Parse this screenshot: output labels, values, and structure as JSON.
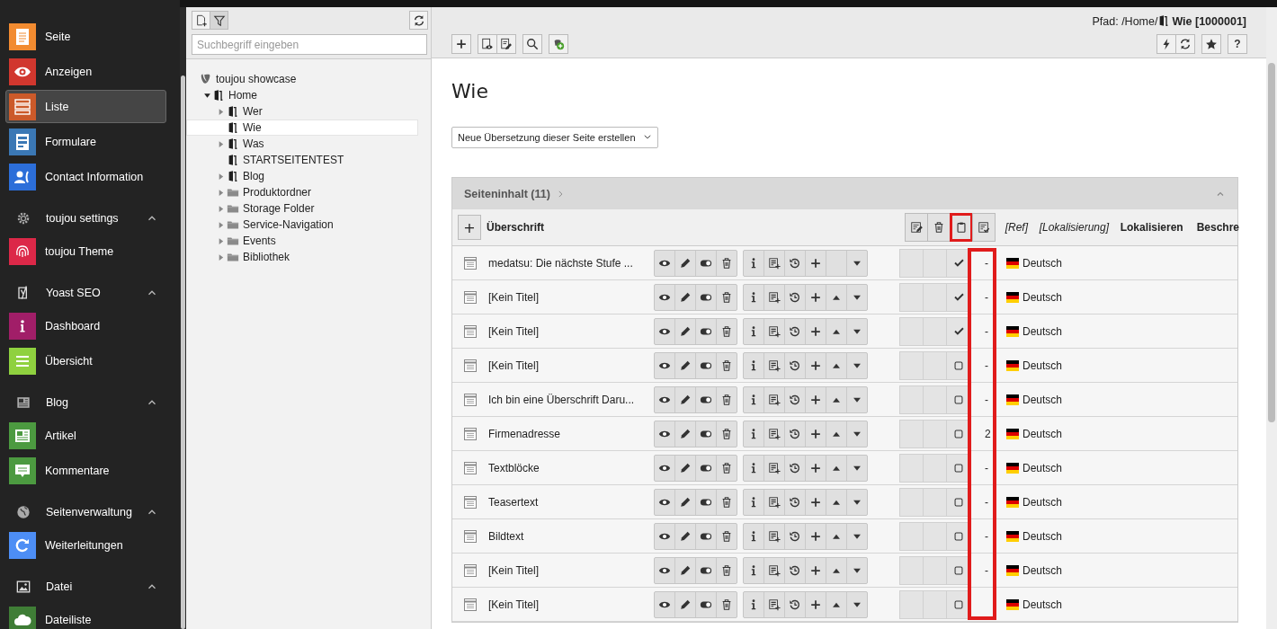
{
  "sidebar": {
    "items": [
      {
        "kind": "module",
        "label": "Seite",
        "color": "#f28b30",
        "selected": false
      },
      {
        "kind": "module",
        "label": "Anzeigen",
        "color": "#d1372e",
        "selected": false
      },
      {
        "kind": "module",
        "label": "Liste",
        "color": "#cc5a2a",
        "selected": true
      },
      {
        "kind": "module",
        "label": "Formulare",
        "color": "#3b78b5",
        "selected": false
      },
      {
        "kind": "module",
        "label": "Contact Information",
        "color": "#2c6ed9",
        "selected": false
      },
      {
        "kind": "group",
        "label": "toujou settings",
        "expanded": true,
        "children": [
          {
            "kind": "module",
            "label": "toujou Theme",
            "color": "#dc2848",
            "selected": false
          }
        ]
      },
      {
        "kind": "group",
        "label": "Yoast SEO",
        "expanded": true,
        "children": [
          {
            "kind": "module",
            "label": "Dashboard",
            "color": "#a11e68",
            "selected": false
          },
          {
            "kind": "module",
            "label": "Übersicht",
            "color": "#8fd13f",
            "selected": false
          }
        ]
      },
      {
        "kind": "group",
        "label": "Blog",
        "expanded": true,
        "children": [
          {
            "kind": "module",
            "label": "Artikel",
            "color": "#4c9a40",
            "selected": false
          },
          {
            "kind": "module",
            "label": "Kommentare",
            "color": "#4c9a40",
            "selected": false
          }
        ]
      },
      {
        "kind": "group",
        "label": "Seitenverwaltung",
        "expanded": true,
        "children": [
          {
            "kind": "module",
            "label": "Weiterleitungen",
            "color": "#4d8ef5",
            "selected": false
          }
        ]
      },
      {
        "kind": "group",
        "label": "Datei",
        "expanded": true,
        "children": [
          {
            "kind": "module",
            "label": "Dateiliste",
            "color": "#3f7d36",
            "selected": false
          }
        ]
      }
    ]
  },
  "tree": {
    "toolbar": [
      {
        "kind": "new-page",
        "pressed": false
      },
      {
        "kind": "filter",
        "pressed": true
      }
    ],
    "search": {
      "placeholder": "Suchbegriff eingeben"
    },
    "nodes": [
      {
        "kind": "root",
        "label": "toujou showcase",
        "selected": false,
        "children": [
          {
            "kind": "page",
            "label": "Home",
            "selected": false,
            "expanded": true,
            "children": [
              {
                "kind": "page",
                "label": "Wer",
                "selected": false,
                "expanded": false
              },
              {
                "kind": "page",
                "label": "Wie",
                "selected": true
              },
              {
                "kind": "page",
                "label": "Was",
                "selected": false,
                "expanded": false
              },
              {
                "kind": "page",
                "label": "STARTSEITENTEST",
                "selected": false
              },
              {
                "kind": "page",
                "label": "Blog",
                "selected": false,
                "expanded": false
              },
              {
                "kind": "folder",
                "label": "Produktordner",
                "selected": false,
                "expanded": false
              },
              {
                "kind": "folder",
                "label": "Storage Folder",
                "selected": false,
                "expanded": false
              },
              {
                "kind": "folder",
                "label": "Service-Navigation",
                "selected": false,
                "expanded": false
              },
              {
                "kind": "folder",
                "label": "Events",
                "selected": false,
                "expanded": false
              },
              {
                "kind": "folder",
                "label": "Bibliothek",
                "selected": false,
                "expanded": false
              }
            ]
          }
        ]
      }
    ]
  },
  "doc_header": {
    "path_label": "Pfad: /Home/",
    "page_title": "Wie [1000001]",
    "help_label": "?"
  },
  "page": {
    "title": "Wie",
    "translation_select": "Neue Übersetzung dieser Seite erstellen",
    "panel": {
      "title": "Seiteninhalt (11)",
      "expanded": true,
      "check_column_highlighted": true,
      "add_label": "+",
      "columns": [
        {
          "label": "Überschrift",
          "italic": false
        },
        {
          "label": "[Ref]",
          "italic": true
        },
        {
          "label": "[Lokalisierung]",
          "italic": true
        },
        {
          "label": "Lokalisieren",
          "italic": false
        },
        {
          "label": "Beschre",
          "italic": false
        }
      ],
      "clipboard_actions": [
        {
          "kind": "edit-selected",
          "highlighted": false
        },
        {
          "kind": "delete-selected",
          "highlighted": false
        },
        {
          "kind": "paste",
          "highlighted": true
        },
        {
          "kind": "select",
          "highlighted": false
        }
      ],
      "rows": [
        {
          "title": "medatsu: Die nächste Stufe ...",
          "checked": true,
          "movable_up": false,
          "ref": "-",
          "language": "Deutsch"
        },
        {
          "title": "[Kein Titel]",
          "checked": true,
          "movable_up": true,
          "ref": "-",
          "language": "Deutsch"
        },
        {
          "title": "[Kein Titel]",
          "checked": true,
          "movable_up": true,
          "ref": "-",
          "language": "Deutsch"
        },
        {
          "title": "[Kein Titel]",
          "checked": false,
          "movable_up": true,
          "ref": "-",
          "language": "Deutsch"
        },
        {
          "title": "Ich bin eine Überschrift Daru...",
          "checked": false,
          "movable_up": true,
          "ref": "-",
          "language": "Deutsch"
        },
        {
          "title": "Firmenadresse",
          "checked": false,
          "movable_up": true,
          "ref": "2",
          "language": "Deutsch"
        },
        {
          "title": "Textblöcke",
          "checked": false,
          "movable_up": true,
          "ref": "-",
          "language": "Deutsch"
        },
        {
          "title": "Teasertext",
          "checked": false,
          "movable_up": true,
          "ref": "-",
          "language": "Deutsch"
        },
        {
          "title": "Bildtext",
          "checked": false,
          "movable_up": true,
          "ref": "-",
          "language": "Deutsch"
        },
        {
          "title": "[Kein Titel]",
          "checked": false,
          "movable_up": true,
          "ref": "-",
          "language": "Deutsch"
        },
        {
          "title": "[Kein Titel]",
          "checked": false,
          "movable_up": true,
          "language": "Deutsch"
        }
      ]
    }
  }
}
